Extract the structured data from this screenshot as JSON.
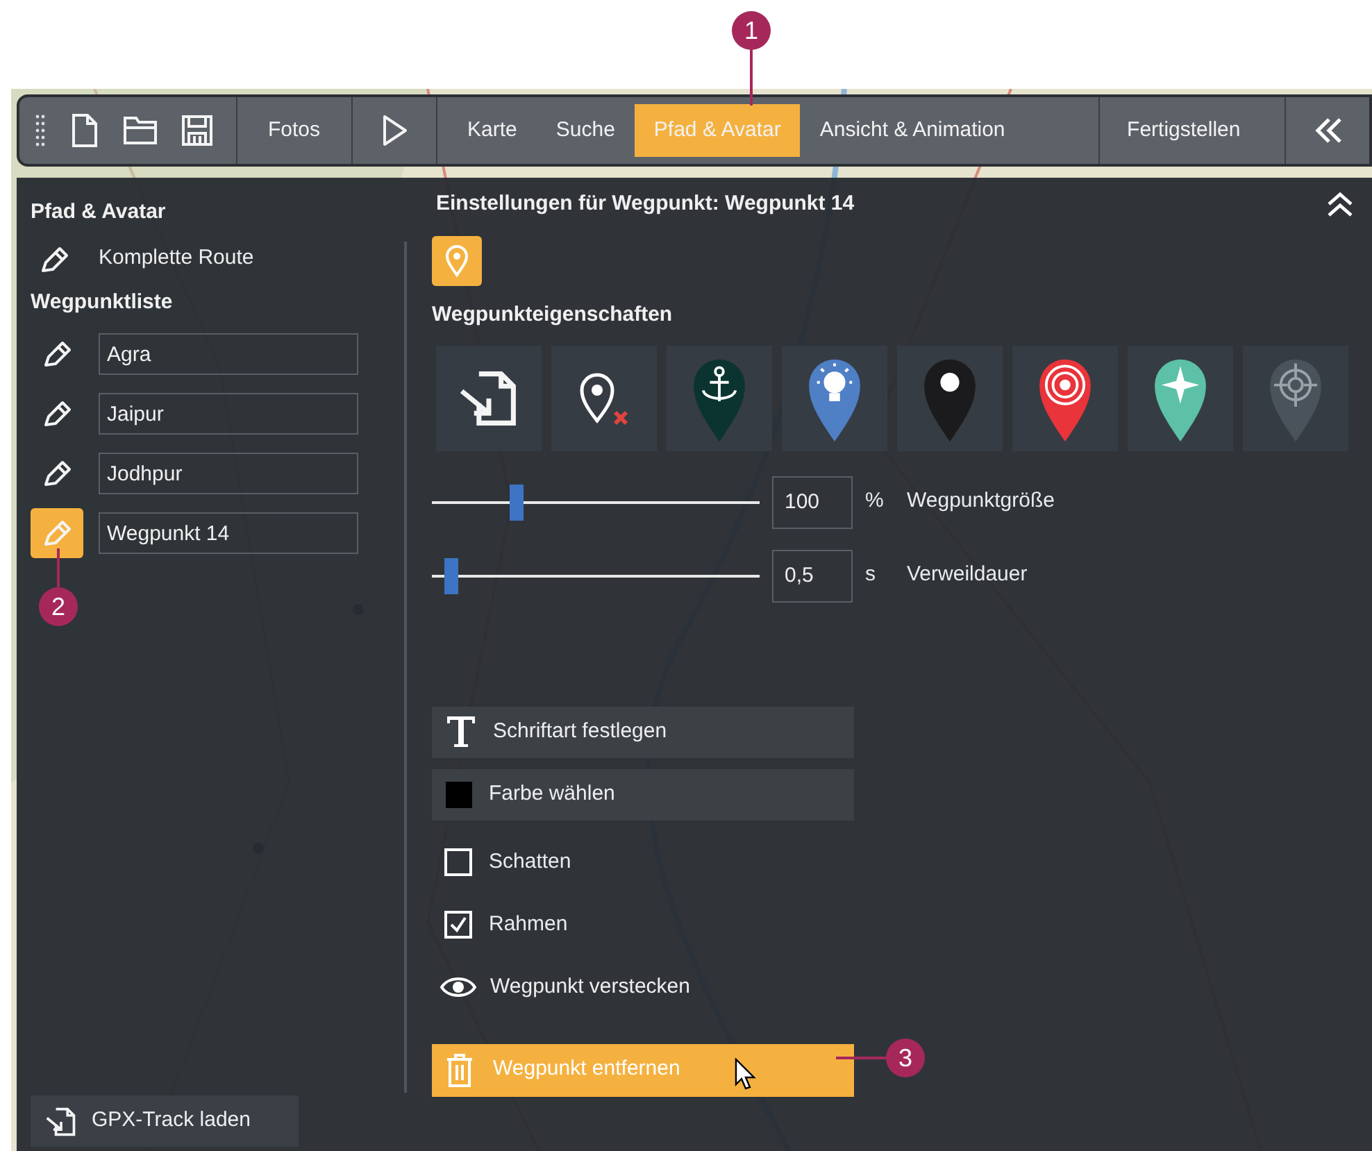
{
  "toolbar": {
    "photos_button": "Fotos",
    "tabs": [
      {
        "label": "Karte",
        "selected": false
      },
      {
        "label": "Suche",
        "selected": false
      },
      {
        "label": "Pfad & Avatar",
        "selected": true
      },
      {
        "label": "Ansicht & Animation",
        "selected": false
      },
      {
        "label": "Fertigstellen",
        "selected": false
      }
    ]
  },
  "left_panel": {
    "title": "Pfad & Avatar",
    "route_button": "Komplette Route",
    "list_title": "Wegpunktliste",
    "waypoints": [
      {
        "name": "Agra",
        "selected": false
      },
      {
        "name": "Jaipur",
        "selected": false
      },
      {
        "name": "Jodhpur",
        "selected": false
      },
      {
        "name": "Wegpunkt 14",
        "selected": true
      }
    ],
    "gpx_button": "GPX-Track laden"
  },
  "right_panel": {
    "title": "Einstellungen für Wegpunkt: Wegpunkt 14",
    "section_title": "Wegpunkteigenschaften",
    "markers": [
      {
        "kind": "import"
      },
      {
        "kind": "remove"
      },
      {
        "kind": "anchor",
        "color": "#0b3431"
      },
      {
        "kind": "bulb",
        "color": "#4f7fc4"
      },
      {
        "kind": "dot",
        "color": "#1b1b1e"
      },
      {
        "kind": "target",
        "color": "#e8343a"
      },
      {
        "kind": "compass",
        "color": "#5cc1a6"
      },
      {
        "kind": "crosshair",
        "color": "#4a525b"
      }
    ],
    "sliders": [
      {
        "level": 0.26,
        "value": "100",
        "unit": "%",
        "label": "Wegpunktgröße"
      },
      {
        "level": 0.06,
        "value": "0,5",
        "unit": "s",
        "label": "Verweildauer"
      }
    ],
    "font_button": "Schriftart festlegen",
    "color_button": {
      "label": "Farbe wählen",
      "color": "#000000"
    },
    "checkboxes": [
      {
        "label": "Schatten",
        "checked": false
      },
      {
        "label": "Rahmen",
        "checked": true
      }
    ],
    "hide_button": "Wegpunkt verstecken",
    "delete_button": "Wegpunkt entfernen"
  },
  "callouts": [
    "1",
    "2",
    "3"
  ]
}
